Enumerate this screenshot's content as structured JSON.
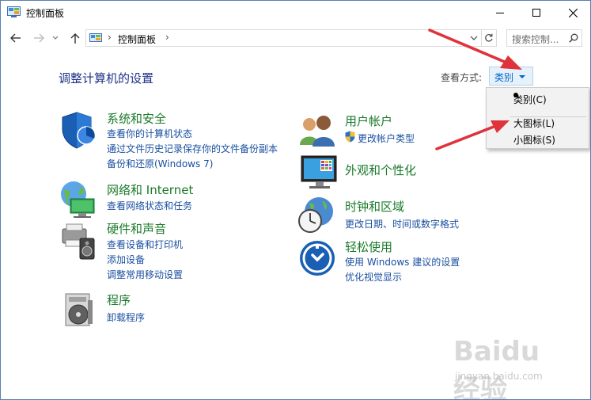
{
  "window": {
    "title": "控制面板"
  },
  "address": {
    "path": "控制面板",
    "separator": "›"
  },
  "search": {
    "placeholder": "搜索控制..."
  },
  "header": {
    "title": "调整计算机的设置",
    "view_by_label": "查看方式:",
    "view_by_value": "类别"
  },
  "view_menu": {
    "items": [
      {
        "label": "类别(C)",
        "selected": true
      },
      {
        "label": "大图标(L)",
        "selected": false
      },
      {
        "label": "小图标(S)",
        "selected": false
      }
    ]
  },
  "categories": {
    "system_security": {
      "title": "系统和安全",
      "links": [
        "查看你的计算机状态",
        "通过文件历史记录保存你的文件备份副本",
        "备份和还原(Windows 7)"
      ]
    },
    "network": {
      "title": "网络和 Internet",
      "links": [
        "查看网络状态和任务"
      ]
    },
    "hardware": {
      "title": "硬件和声音",
      "links": [
        "查看设备和打印机",
        "添加设备",
        "调整常用移动设置"
      ]
    },
    "programs": {
      "title": "程序",
      "links": [
        "卸载程序"
      ]
    },
    "user_accounts": {
      "title": "用户帐户",
      "links": [
        "更改帐户类型"
      ]
    },
    "appearance": {
      "title": "外观和个性化",
      "links": []
    },
    "clock_region": {
      "title": "时钟和区域",
      "links": [
        "更改日期、时间或数字格式"
      ]
    },
    "ease_access": {
      "title": "轻松使用",
      "links": [
        "使用 Windows 建议的设置",
        "优化视觉显示"
      ]
    }
  },
  "watermark": {
    "text": "Baidu经验",
    "sub": "jingyan.baidu.com"
  },
  "colors": {
    "category_title": "#1a7a2a",
    "link": "#1a4fa0",
    "page_title": "#1e3287",
    "arrow": "#e0323a"
  }
}
